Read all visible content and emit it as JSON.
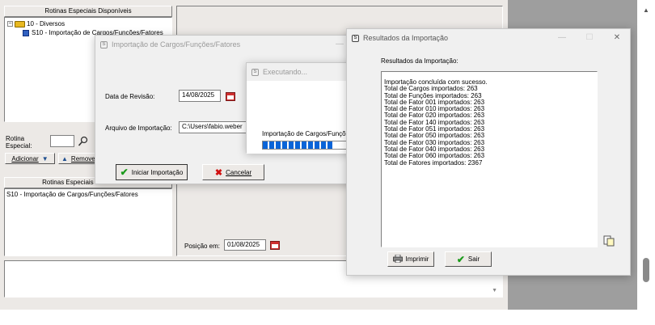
{
  "main": {
    "left_panel_title": "Rotinas Especiais Disponíveis",
    "tree_root": "10 - Diversos",
    "tree_child": "S10 - Importação de Cargos/Funções/Fatores",
    "rotina_label_line1": "Rotina",
    "rotina_label_line2": "Especial:",
    "add_label": "Adicionar",
    "remove_label": "Remover",
    "second_panel_title": "Rotinas Especiais Selecionadas",
    "selected_item": "S10 - Importação de Cargos/Funções/Fatores",
    "posicao_label": "Posição em:",
    "posicao_value": "01/08/2025"
  },
  "import_dialog": {
    "title": "Importação de Cargos/Funções/Fatores",
    "data_revisao_label": "Data de Revisão:",
    "data_revisao_value": "14/08/2025",
    "arquivo_label": "Arquivo de Importação:",
    "arquivo_value": "C:\\Users\\fabio.weber",
    "iniciar_label": "Iniciar Importação",
    "cancelar_label": "Cancelar"
  },
  "executando": {
    "title": "Executando...",
    "status_text": "Importação de Cargos/Funções/Fatores",
    "progress": 0.8
  },
  "results": {
    "title": "Resultados da Importação",
    "heading": "Resultados da Importação:",
    "lines": [
      "Importação concluída com sucesso.",
      "Total de Cargos importados: 263",
      "Total de Funções importados: 263",
      "Total de Fator 001 importados: 263",
      "Total de Fator 010 importados: 263",
      "Total de Fator 020 importados: 263",
      "Total de Fator 140 importados: 263",
      "Total de Fator 051 importados: 263",
      "Total de Fator 050 importados: 263",
      "Total de Fator 030 importados: 263",
      "Total de Fator 040 importados: 263",
      "Total de Fator 060 importados: 263",
      "Total de Fatores importados: 2367"
    ],
    "imprimir_label": "Imprimir",
    "sair_label": "Sair"
  },
  "window_controls": {
    "minimize": "—",
    "maximize": "☐",
    "close": "✕"
  },
  "colors": {
    "accent_progress": "#0a64d8",
    "check_green": "#1a9a1a",
    "cancel_red": "#d01010"
  },
  "icons": [
    "folder-icon",
    "table-icon",
    "search-icon",
    "arrow-down-icon",
    "arrow-up-icon",
    "calendar-icon",
    "check-icon",
    "x-icon",
    "printer-icon",
    "copy-icon",
    "scroll-up-icon",
    "scroll-down-icon"
  ]
}
